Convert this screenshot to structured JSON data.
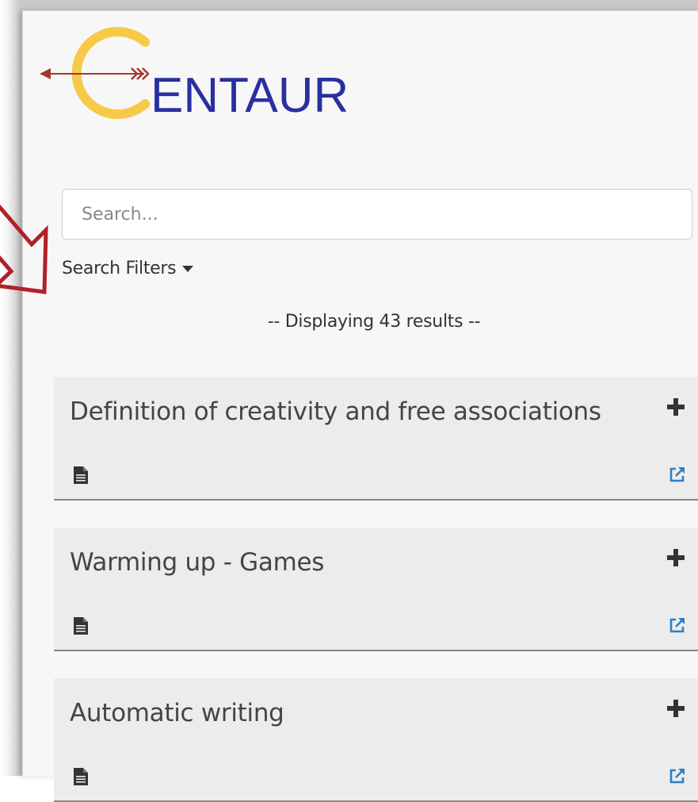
{
  "brand": {
    "name": "ENTAUR",
    "colors": {
      "ring": "#f7c948",
      "arrow": "#a13a2e",
      "text": "#2a2fa0"
    }
  },
  "search": {
    "placeholder": "Search..."
  },
  "filters": {
    "label": "Search Filters"
  },
  "results": {
    "count_text": "-- Displaying 43 results --",
    "items": [
      {
        "title": "Definition of creativity and free associations",
        "icon": "document-icon",
        "link_icon": "external-link-icon"
      },
      {
        "title": "Warming up - Games",
        "icon": "document-icon",
        "link_icon": "external-link-icon"
      },
      {
        "title": "Automatic writing",
        "icon": "document-icon",
        "link_icon": "external-link-icon"
      }
    ]
  },
  "annotation": {
    "arrow_color": "#b2202a"
  },
  "colors": {
    "link_blue": "#2f7fc1",
    "card_bg": "#ececec",
    "text_dark": "#444444"
  }
}
